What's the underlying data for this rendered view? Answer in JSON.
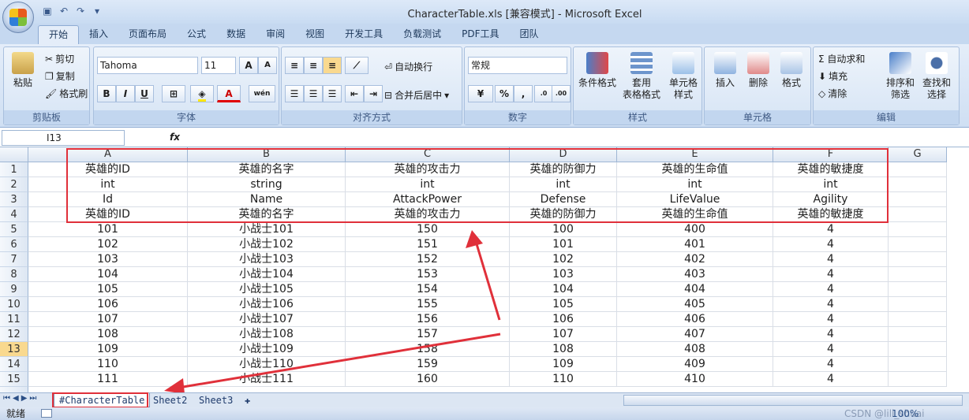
{
  "window": {
    "title": "CharacterTable.xls  [兼容模式] - Microsoft Excel"
  },
  "ribbon_tabs": [
    "开始",
    "插入",
    "页面布局",
    "公式",
    "数据",
    "审阅",
    "视图",
    "开发工具",
    "负载测试",
    "PDF工具",
    "团队"
  ],
  "clipboard": {
    "label": "剪贴板",
    "paste": "粘贴",
    "cut": "剪切",
    "copy": "复制",
    "format_painter": "格式刷"
  },
  "font": {
    "label": "字体",
    "name": "Tahoma",
    "size": "11",
    "bold": "B",
    "italic": "I",
    "underline": "U",
    "grow": "A",
    "shrink": "A",
    "color_a": "A",
    "wen": "wén"
  },
  "alignment": {
    "label": "对齐方式",
    "wrap": "自动换行",
    "merge": "合并后居中"
  },
  "number": {
    "label": "数字",
    "format": "常规",
    "percent": "%",
    "comma": ",",
    "inc": "←.0 .00",
    "dec": ".00 →.0"
  },
  "styles": {
    "label": "样式",
    "conditional": "条件格式",
    "table": "套用\n表格格式",
    "cell_styles": "单元格\n样式"
  },
  "cells": {
    "label": "单元格",
    "insert": "插入",
    "delete": "删除",
    "format": "格式"
  },
  "editing": {
    "label": "编辑",
    "autosum": "Σ 自动求和",
    "fill": "填充",
    "clear": "清除",
    "sort": "排序和\n筛选",
    "find": "查找和\n选择"
  },
  "formula_bar": {
    "name_box": "I13",
    "fx": "fx",
    "value": ""
  },
  "columns": [
    "A",
    "B",
    "C",
    "D",
    "E",
    "F",
    "G"
  ],
  "rows": [
    {
      "n": "1",
      "c": [
        "英雄的ID",
        "英雄的名字",
        "英雄的攻击力",
        "英雄的防御力",
        "英雄的生命值",
        "英雄的敏捷度",
        ""
      ]
    },
    {
      "n": "2",
      "c": [
        "int",
        "string",
        "int",
        "int",
        "int",
        "int",
        ""
      ]
    },
    {
      "n": "3",
      "c": [
        "Id",
        "Name",
        "AttackPower",
        "Defense",
        "LifeValue",
        "Agility",
        ""
      ]
    },
    {
      "n": "4",
      "c": [
        "英雄的ID",
        "英雄的名字",
        "英雄的攻击力",
        "英雄的防御力",
        "英雄的生命值",
        "英雄的敏捷度",
        ""
      ]
    },
    {
      "n": "5",
      "c": [
        "101",
        "小战士101",
        "150",
        "100",
        "400",
        "4",
        ""
      ]
    },
    {
      "n": "6",
      "c": [
        "102",
        "小战士102",
        "151",
        "101",
        "401",
        "4",
        ""
      ]
    },
    {
      "n": "7",
      "c": [
        "103",
        "小战士103",
        "152",
        "102",
        "402",
        "4",
        ""
      ]
    },
    {
      "n": "8",
      "c": [
        "104",
        "小战士104",
        "153",
        "103",
        "403",
        "4",
        ""
      ]
    },
    {
      "n": "9",
      "c": [
        "105",
        "小战士105",
        "154",
        "104",
        "404",
        "4",
        ""
      ]
    },
    {
      "n": "10",
      "c": [
        "106",
        "小战士106",
        "155",
        "105",
        "405",
        "4",
        ""
      ]
    },
    {
      "n": "11",
      "c": [
        "107",
        "小战士107",
        "156",
        "106",
        "406",
        "4",
        ""
      ]
    },
    {
      "n": "12",
      "c": [
        "108",
        "小战士108",
        "157",
        "107",
        "407",
        "4",
        ""
      ]
    },
    {
      "n": "13",
      "c": [
        "109",
        "小战士109",
        "158",
        "108",
        "408",
        "4",
        ""
      ]
    },
    {
      "n": "14",
      "c": [
        "110",
        "小战士110",
        "159",
        "109",
        "409",
        "4",
        ""
      ]
    },
    {
      "n": "15",
      "c": [
        "111",
        "小战士111",
        "160",
        "110",
        "410",
        "4",
        ""
      ]
    }
  ],
  "sheets": [
    "#CharacterTable",
    "Sheet2",
    "Sheet3"
  ],
  "status": {
    "ready": "就绪",
    "zoom": "100%",
    "watermark": "CSDN @lili_shuai"
  },
  "colors": {
    "annotation": "#e0303a",
    "selected_row": "#f9d98f"
  }
}
